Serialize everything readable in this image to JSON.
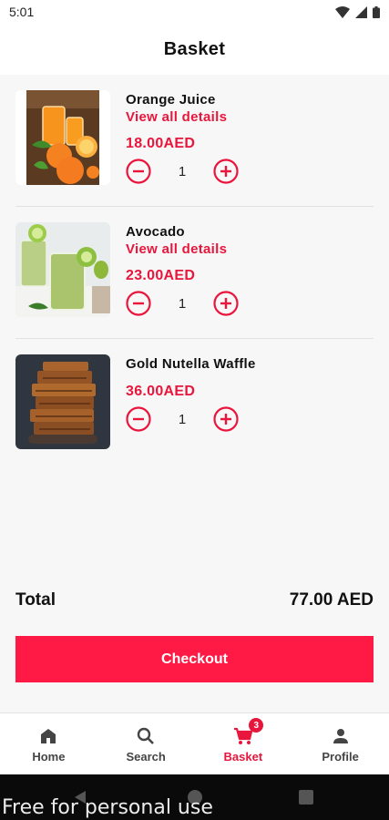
{
  "status_bar": {
    "time": "5:01"
  },
  "header": {
    "title": "Basket"
  },
  "items": [
    {
      "name": "Orange Juice",
      "details_label": "View all details",
      "price": "18.00AED",
      "quantity": "1"
    },
    {
      "name": "Avocado",
      "details_label": "View all details",
      "price": "23.00AED",
      "quantity": "1"
    },
    {
      "name": "Gold Nutella Waffle",
      "price": "36.00AED",
      "quantity": "1"
    }
  ],
  "summary": {
    "total_label": "Total",
    "total_value": "77.00 AED"
  },
  "checkout": {
    "label": "Checkout"
  },
  "bottom_nav": {
    "items": [
      {
        "label": "Home",
        "icon": "home-icon"
      },
      {
        "label": "Search",
        "icon": "search-icon"
      },
      {
        "label": "Basket",
        "icon": "cart-icon",
        "badge": "3",
        "active": true
      },
      {
        "label": "Profile",
        "icon": "person-icon"
      }
    ]
  },
  "watermark": "Free for personal use",
  "colors": {
    "accent": "#e8163c",
    "button": "#ff1a45"
  }
}
